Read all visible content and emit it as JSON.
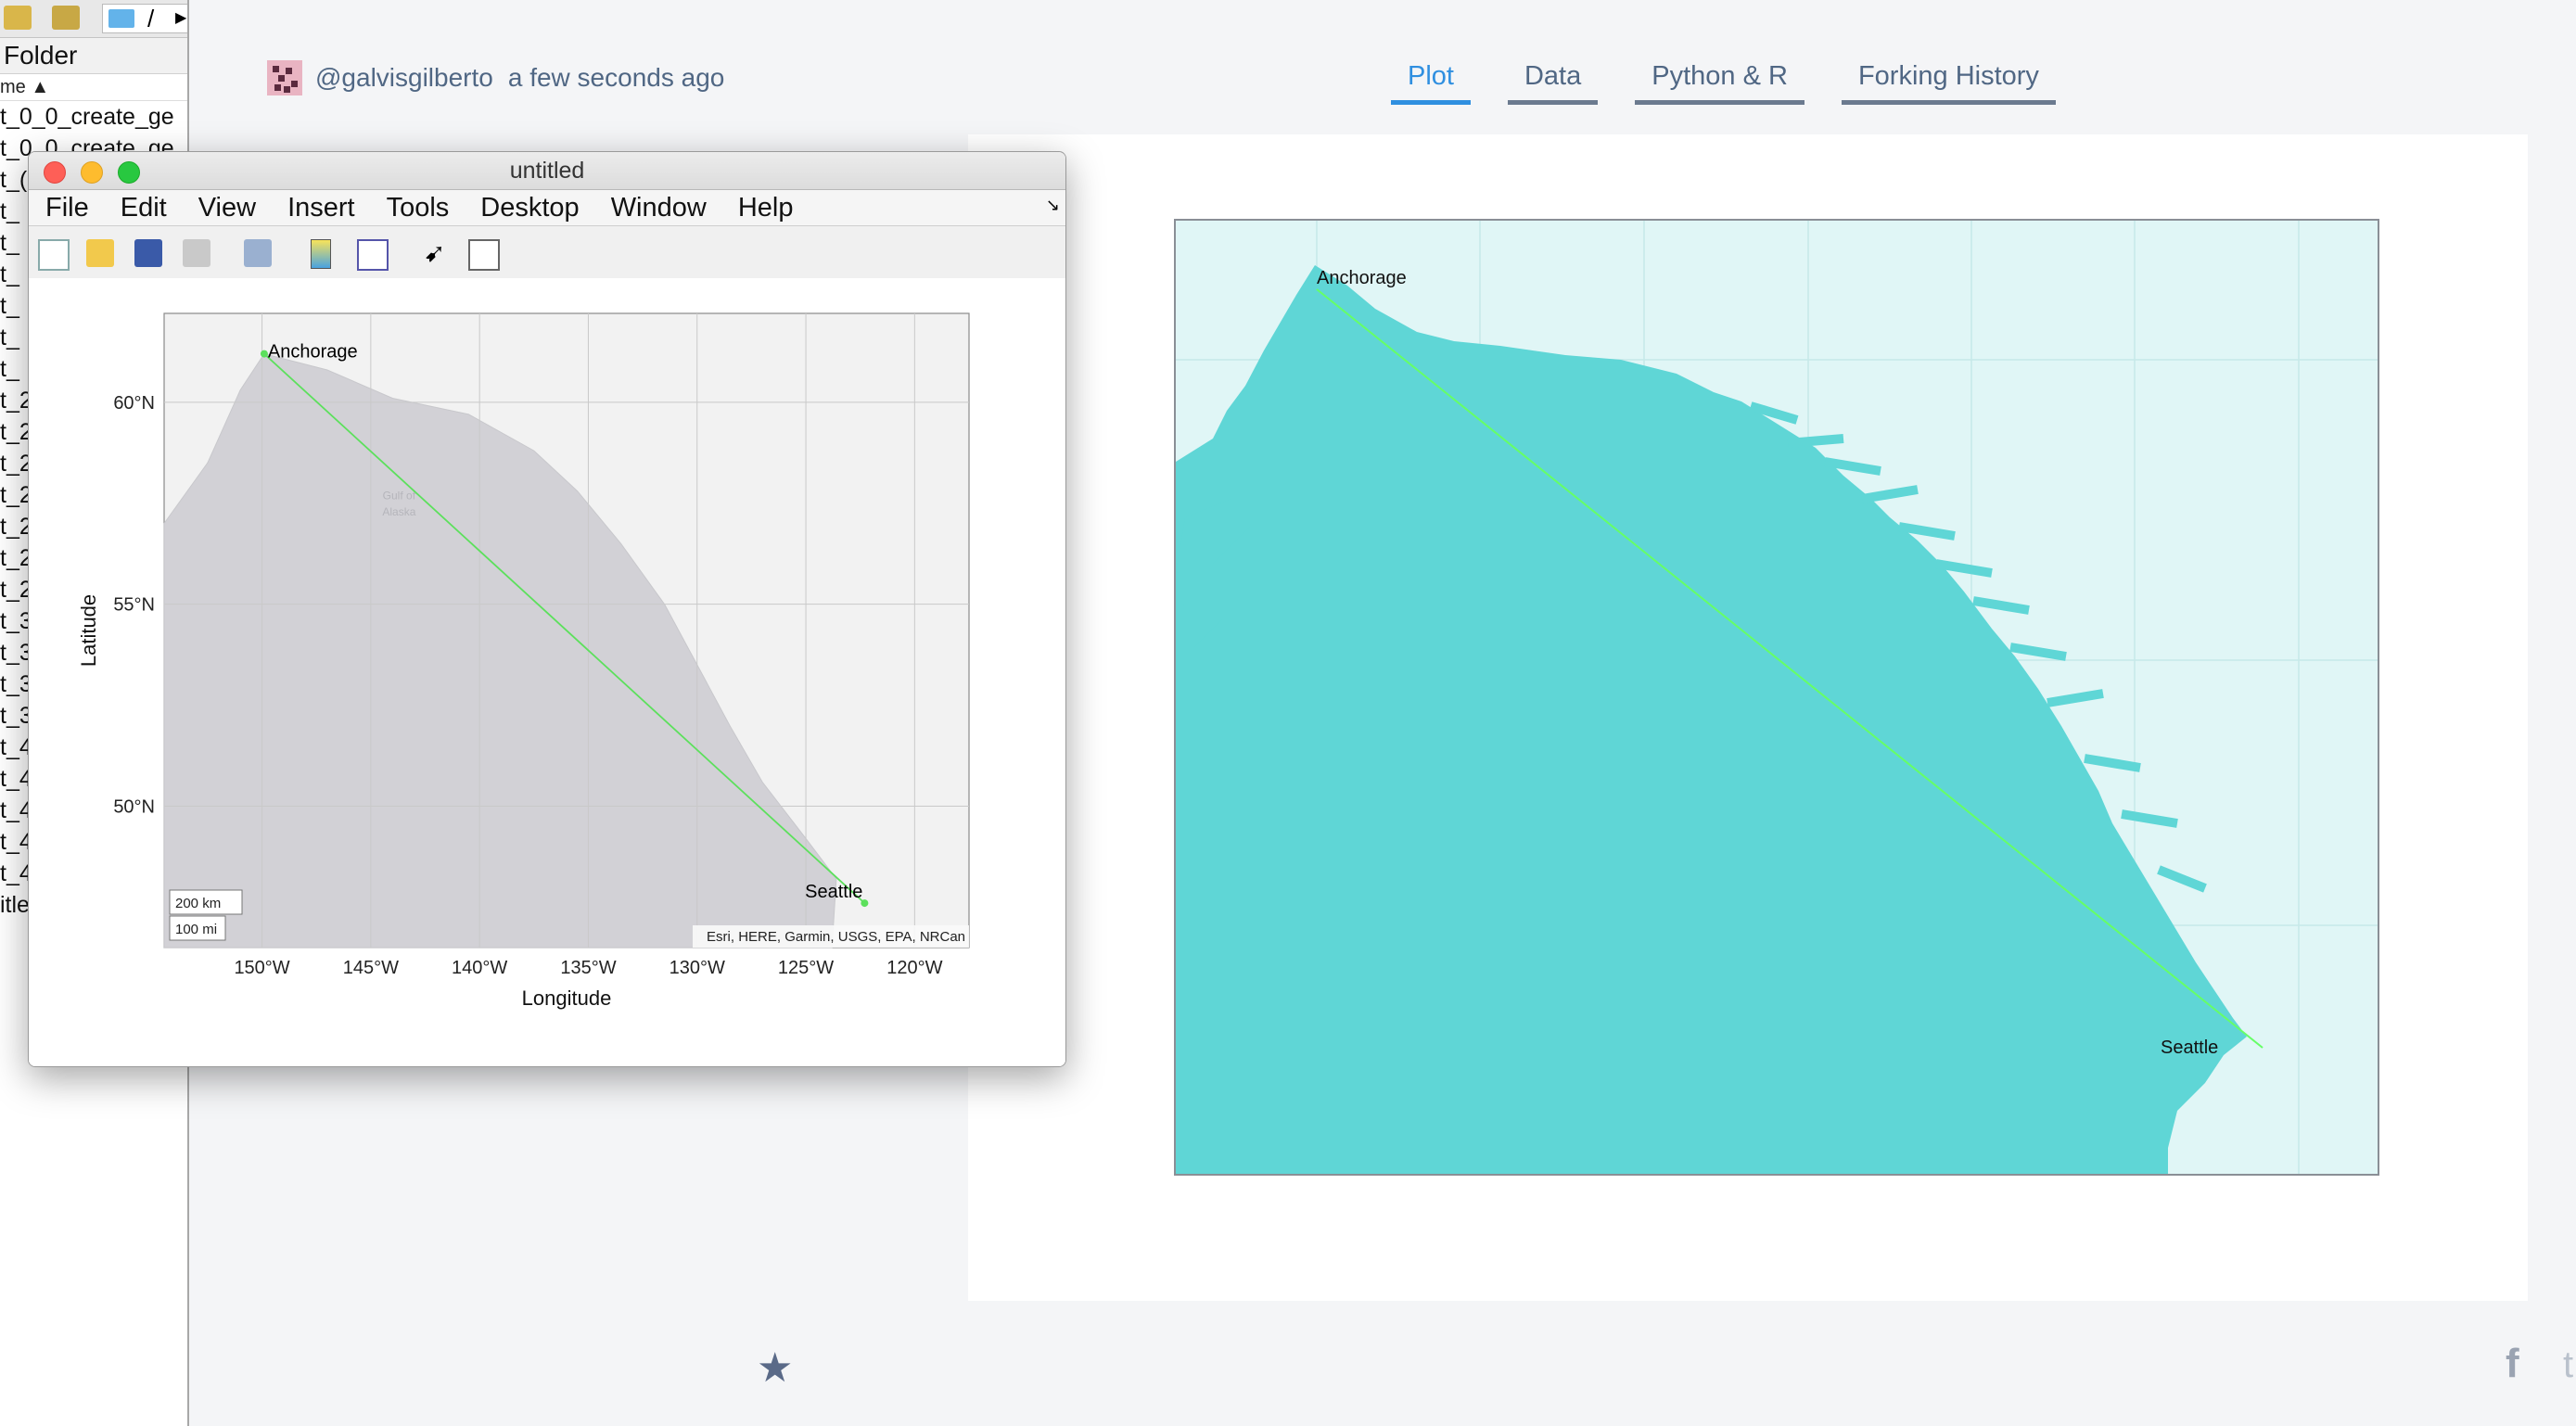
{
  "matlab_folder": {
    "path_text": "/",
    "title": "Folder",
    "column_header": "me ▲",
    "files": [
      "t_0_0_create_ge",
      "t_0_0_create_ge",
      "t_(",
      "t_",
      "t_",
      "t_",
      "t_",
      "t_",
      "t_",
      "t_2",
      "t_2",
      "t_2",
      "t_2",
      "t_2",
      "t_2",
      "t_2",
      "t_3",
      "t_3",
      "t_3",
      "t_3",
      "t_4",
      "t_4",
      "t_4",
      "t_4",
      "t_4",
      "itle"
    ]
  },
  "page": {
    "author": "@galvisgilberto",
    "timestamp": "a few seconds ago",
    "tabs": [
      {
        "label": "Plot",
        "active": true
      },
      {
        "label": "Data",
        "active": false
      },
      {
        "label": "Python & R",
        "active": false
      },
      {
        "label": "Forking History",
        "active": false
      }
    ],
    "star_icon": "★",
    "facebook_icon": "f",
    "twitter_icon": "t"
  },
  "big_map": {
    "labels": {
      "start": "Anchorage",
      "end": "Seattle"
    },
    "colors": {
      "water": "#e0f6f6",
      "land": "#5fd6d6",
      "route": "#66ff66"
    }
  },
  "figure_window": {
    "title": "untitled",
    "menu": [
      "File",
      "Edit",
      "View",
      "Insert",
      "Tools",
      "Desktop",
      "Window",
      "Help"
    ],
    "toolbar_icons": [
      "new-figure-icon",
      "open-file-icon",
      "save-icon",
      "print-icon",
      "link-plot-icon",
      "colorbar-icon",
      "legend-icon",
      "pointer-icon",
      "property-inspector-icon"
    ]
  },
  "chart_data": {
    "type": "line",
    "title": "",
    "xlabel": "Longitude",
    "ylabel": "Latitude",
    "xlim": [
      -154.5,
      -117.5
    ],
    "ylim": [
      46.5,
      62.2
    ],
    "x_ticks": [
      -150,
      -145,
      -140,
      -135,
      -130,
      -125,
      -120
    ],
    "x_tick_labels": [
      "150°W",
      "145°W",
      "140°W",
      "135°W",
      "130°W",
      "125°W",
      "120°W"
    ],
    "y_ticks": [
      60,
      55,
      50
    ],
    "y_tick_labels": [
      "60°N",
      "55°N",
      "50°N"
    ],
    "grid": true,
    "series": [
      {
        "x": [
          -149.9,
          -122.3
        ],
        "y": [
          61.2,
          47.6
        ],
        "color": "#5ce05c"
      }
    ],
    "annotations": [
      {
        "text": "Anchorage",
        "x": -149.9,
        "y": 61.2
      },
      {
        "text": "Seattle",
        "x": -122.3,
        "y": 47.6
      }
    ],
    "basemap_labels": [
      "Gulf of",
      "Alaska"
    ],
    "scale_bar": [
      "200 km",
      "100 mi"
    ],
    "attribution": "Esri, HERE, Garmin, USGS, EPA, NRCan"
  }
}
